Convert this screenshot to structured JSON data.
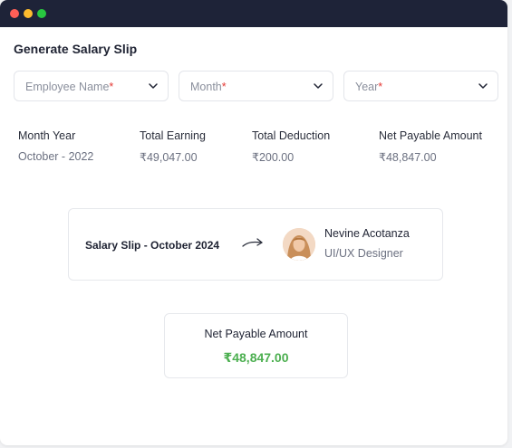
{
  "page": {
    "title": "Generate Salary Slip"
  },
  "filters": [
    {
      "label": "Employee Name",
      "required_mark": "*"
    },
    {
      "label": "Month",
      "required_mark": "*"
    },
    {
      "label": "Year",
      "required_mark": "*"
    }
  ],
  "summary": {
    "headers": [
      "Month Year",
      "Total Earning",
      "Total Deduction",
      "Net Payable Amount"
    ],
    "values": [
      "October - 2022",
      "₹49,047.00",
      "₹200.00",
      "₹48,847.00"
    ]
  },
  "slip_card": {
    "title": "Salary Slip - October 2024",
    "employee_name": "Nevine Acotanza",
    "employee_role": "UI/UX Designer"
  },
  "net_card": {
    "label": "Net Payable Amount",
    "value": "₹48,847.00"
  },
  "colors": {
    "titlebar": "#1e2338",
    "accent_green": "#4caf50",
    "required_red": "#e53935"
  }
}
